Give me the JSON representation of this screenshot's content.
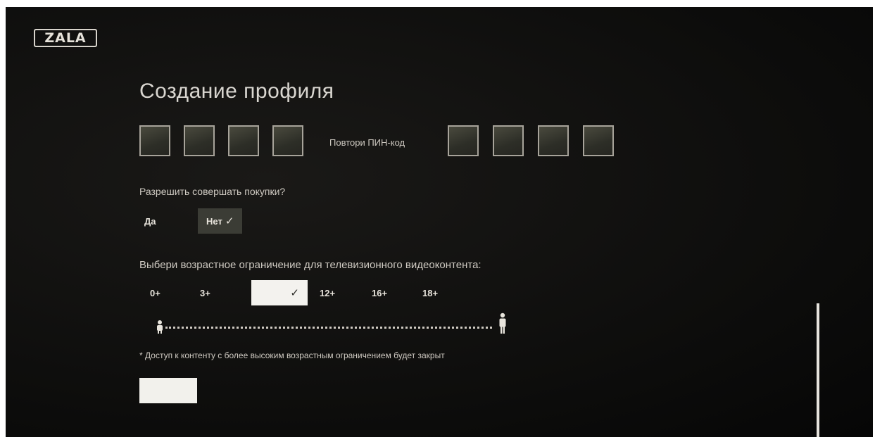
{
  "app": {
    "logo_text": "ZALA"
  },
  "page": {
    "title": "Создание профиля"
  },
  "pin": {
    "repeat_label": "Повтори ПИН-код"
  },
  "purchases": {
    "question": "Разрешить совершать покупки?",
    "options": [
      {
        "label": "Да",
        "selected": false
      },
      {
        "label": "Нет",
        "selected": true
      }
    ],
    "check_mark": "✓"
  },
  "age_limit": {
    "question": "Выбери возрастное ограничение для телевизионного видеоконтента:",
    "options": [
      {
        "label": "0+",
        "selected": false
      },
      {
        "label": "3+",
        "selected": false
      },
      {
        "label": "",
        "selected": true
      },
      {
        "label": "12+",
        "selected": false
      },
      {
        "label": "16+",
        "selected": false
      },
      {
        "label": "18+",
        "selected": false
      }
    ],
    "check_mark": "✓",
    "note": "* Доступ к контенту с более высоким возрастным ограничением будет закрыт",
    "icons": {
      "left": "child-icon",
      "right": "adult-icon"
    }
  }
}
